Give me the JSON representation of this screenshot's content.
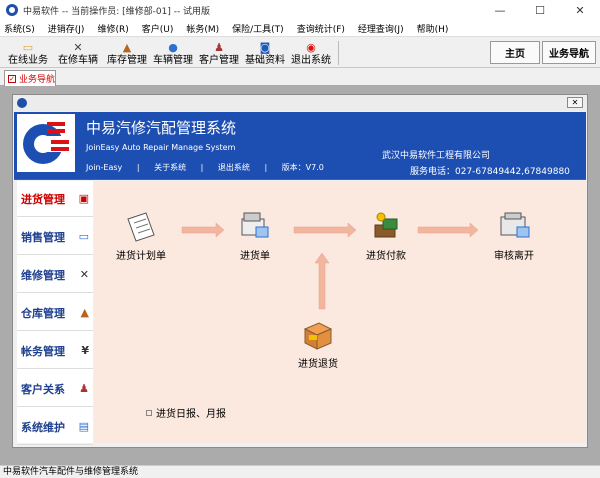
{
  "window": {
    "title": "中易软件 -- 当前操作员: [维修部-01] -- 试用版",
    "controls": {
      "minimize": "—",
      "maximize": "☐",
      "close": "✕"
    }
  },
  "menu": [
    "系统(S)",
    "进销存(J)",
    "维修(R)",
    "客户(U)",
    "帐务(M)",
    "保险/工具(T)",
    "查询统计(F)",
    "经理查询(J)",
    "帮助(H)"
  ],
  "toolbar": {
    "buttons": [
      {
        "label": "在线业务",
        "icon": "folder-icon"
      },
      {
        "label": "在修车辆",
        "icon": "tools-icon"
      },
      {
        "label": "库存管理",
        "icon": "warehouse-icon"
      },
      {
        "label": "车辆管理",
        "icon": "car-icon"
      },
      {
        "label": "客户管理",
        "icon": "person-icon"
      },
      {
        "label": "基础资料",
        "icon": "camera-icon"
      },
      {
        "label": "退出系统",
        "icon": "exit-icon"
      }
    ],
    "home_label": "主页",
    "business_nav_label": "业务导航"
  },
  "tab": {
    "label": "业务导航"
  },
  "banner": {
    "title": "中易汽修汽配管理系统",
    "subtitle": "JoinEasy Auto Repair Manage System",
    "links": [
      "Join-Easy",
      "|",
      "关于系统",
      "|",
      "退出系统",
      "|",
      "版本：V7.0"
    ],
    "company": "武汉中易软件工程有限公司",
    "service": "服务电话：027-67849442,67849880"
  },
  "sidenav": [
    {
      "label": "进货管理",
      "icon": "inbound-icon",
      "glyph": "▣",
      "active": true
    },
    {
      "label": "销售管理",
      "icon": "folder-icon",
      "glyph": "▭",
      "active": false
    },
    {
      "label": "维修管理",
      "icon": "tools-icon",
      "glyph": "✕",
      "active": false
    },
    {
      "label": "仓库管理",
      "icon": "warehouse-icon",
      "glyph": "▲",
      "active": false
    },
    {
      "label": "帐务管理",
      "icon": "ledger-icon",
      "glyph": "¥",
      "active": false
    },
    {
      "label": "客户关系",
      "icon": "person-icon",
      "glyph": "♟",
      "active": false
    },
    {
      "label": "系统维护",
      "icon": "monitor-icon",
      "glyph": "▤",
      "active": false
    }
  ],
  "flow": {
    "nodes": {
      "plan": "进货计划单",
      "order": "进货单",
      "payment": "进货付款",
      "audit": "审核离开",
      "return": "进货退货"
    },
    "report_link": "进货日报、月报"
  },
  "status": {
    "text": "中易软件汽车配件与维修管理系统"
  },
  "colors": {
    "banner": "#1d4fb3",
    "flow_bg": "#fbe9df",
    "nav_text": "#1e3f8f",
    "nav_active": "#cc0000",
    "arrow": "#f2b6a0"
  }
}
